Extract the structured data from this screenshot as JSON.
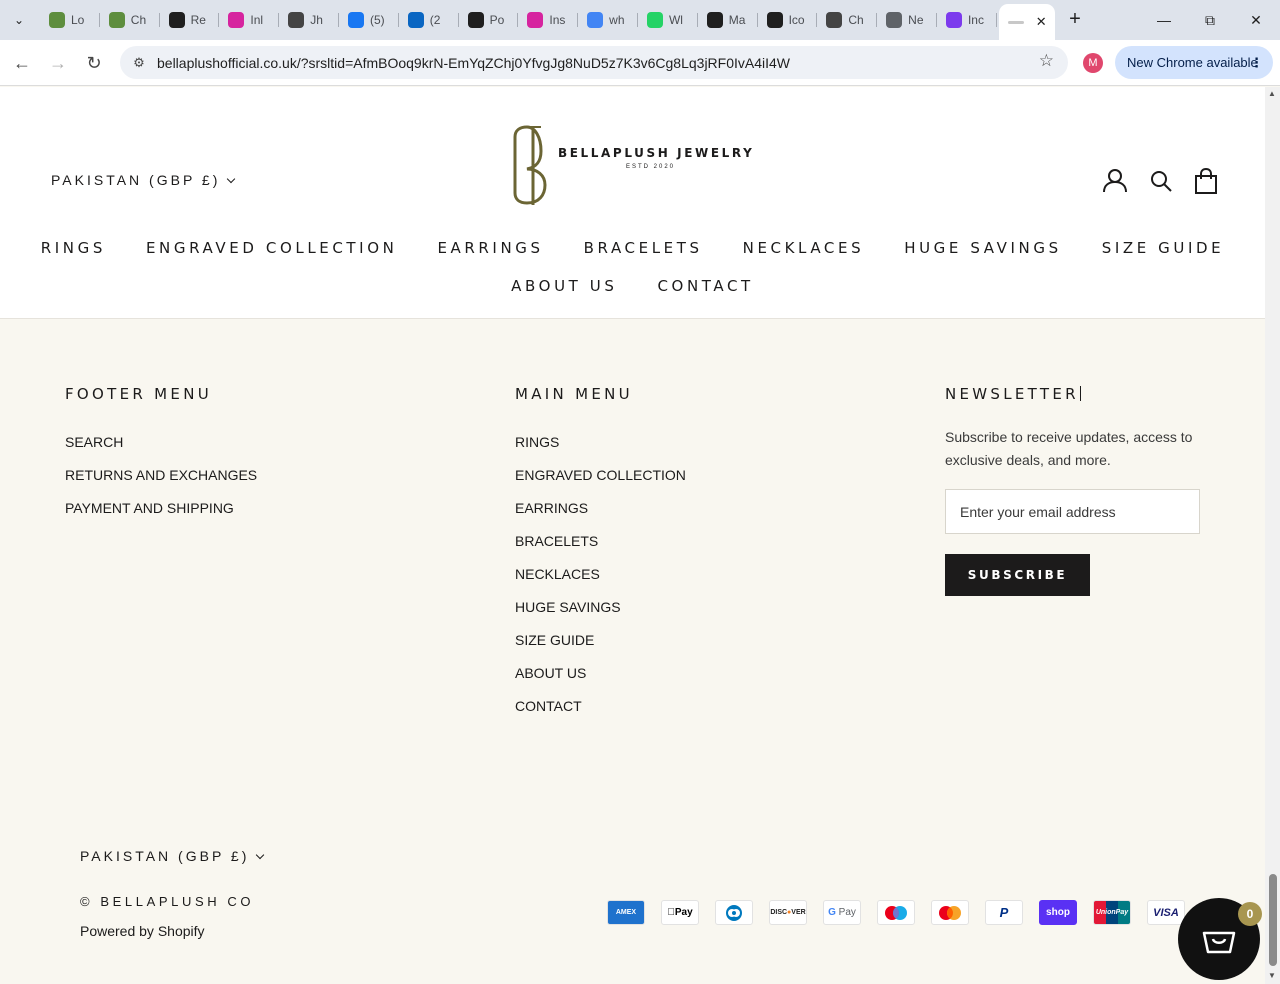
{
  "browser": {
    "tabs": [
      {
        "title": "Lo",
        "icon": "shopify-icon",
        "color": "#5e8e3e"
      },
      {
        "title": "Ch",
        "icon": "shopify-icon",
        "color": "#5e8e3e"
      },
      {
        "title": "Re",
        "icon": "pen-slash-icon",
        "color": "#1f1f1f"
      },
      {
        "title": "Inl",
        "icon": "instagram-icon",
        "color": "#d6249f"
      },
      {
        "title": "Jh",
        "icon": "ms-logo-icon",
        "color": "#444444"
      },
      {
        "title": "(5)",
        "icon": "facebook-icon",
        "color": "#1877f2"
      },
      {
        "title": "(2",
        "icon": "linkedin-icon",
        "color": "#0a66c2"
      },
      {
        "title": "Po",
        "icon": "openai-icon",
        "color": "#1f1f1f"
      },
      {
        "title": "Ins",
        "icon": "instagram-icon",
        "color": "#d6249f"
      },
      {
        "title": "wh",
        "icon": "google-icon",
        "color": "#4285f4"
      },
      {
        "title": "Wl",
        "icon": "whatsapp-icon",
        "color": "#25d366"
      },
      {
        "title": "Ma",
        "icon": "pen-slash-icon",
        "color": "#1f1f1f"
      },
      {
        "title": "Ico",
        "icon": "openai-icon",
        "color": "#1f1f1f"
      },
      {
        "title": "Ch",
        "icon": "ms-logo-icon",
        "color": "#444444"
      },
      {
        "title": "Ne",
        "icon": "chrome-icon",
        "color": "#5f6368"
      },
      {
        "title": "Inc",
        "icon": "b-icon",
        "color": "#7c3aed"
      }
    ],
    "url": "bellaplushofficial.co.uk/?srsltid=AfmBOoq9krN-EmYqZChj0YfvgJg8NuD5z7K3v6Cg8Lq3jRF0IvA4iI4W",
    "profile_initial": "M",
    "update_label": "New Chrome available"
  },
  "header": {
    "country": "PAKISTAN (GBP £)",
    "logo_name": "BELLAPLUSH JEWELRY",
    "logo_estd": "ESTD 2020",
    "nav_row1": [
      "RINGS",
      "ENGRAVED COLLECTION",
      "EARRINGS",
      "BRACELETS",
      "NECKLACES",
      "HUGE SAVINGS",
      "SIZE GUIDE"
    ],
    "nav_row2": [
      "ABOUT US",
      "CONTACT"
    ]
  },
  "footer": {
    "footer_menu": {
      "title": "FOOTER MENU",
      "links": [
        "SEARCH",
        "RETURNS AND EXCHANGES",
        "PAYMENT AND SHIPPING"
      ]
    },
    "main_menu": {
      "title": "MAIN MENU",
      "links": [
        "RINGS",
        "ENGRAVED COLLECTION",
        "EARRINGS",
        "BRACELETS",
        "NECKLACES",
        "HUGE SAVINGS",
        "SIZE GUIDE",
        "ABOUT US",
        "CONTACT"
      ]
    },
    "newsletter": {
      "title": "NEWSLETTER",
      "text": "Subscribe to receive updates, access to exclusive deals, and more.",
      "email_placeholder": "Enter your email address",
      "subscribe_label": "SUBSCRIBE"
    },
    "country": "PAKISTAN (GBP £)",
    "copyright": "© BELLAPLUSH CO",
    "powered": "Powered by Shopify",
    "payments": [
      "American Express",
      "Apple Pay",
      "Diners Club",
      "Discover",
      "Google Pay",
      "Maestro",
      "Mastercard",
      "PayPal",
      "Shop Pay",
      "Union Pay",
      "Visa"
    ]
  },
  "cart": {
    "count": "0"
  },
  "colors": {
    "page_bg": "#f9f7f0",
    "header_bg": "#ffffff",
    "ink": "#1c1b1b",
    "logo_gold": "#6b6534",
    "badge": "#a89650"
  }
}
